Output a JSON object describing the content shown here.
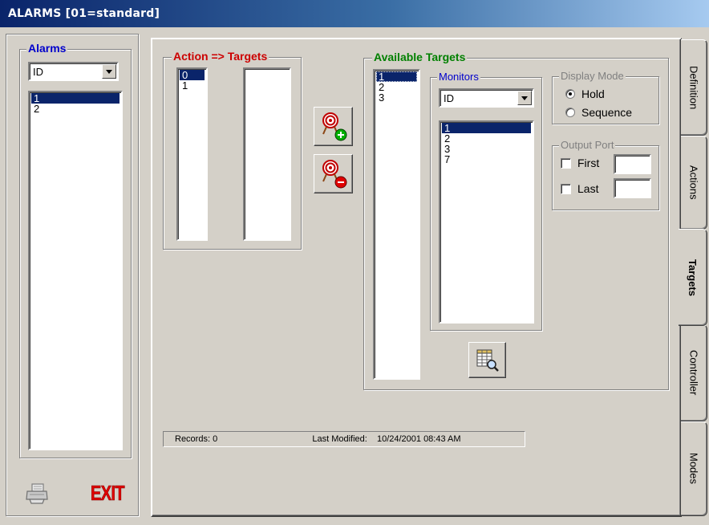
{
  "window": {
    "title": "ALARMS [01=standard]"
  },
  "alarms_panel": {
    "legend": "Alarms",
    "combo_value": "ID",
    "items": [
      "1",
      "2"
    ],
    "selected_index": 0
  },
  "action_targets": {
    "legend_action": "Action",
    "legend_arrow": "=>",
    "legend_targets": "Targets",
    "action_items": [
      "0",
      "1"
    ],
    "target_items": []
  },
  "buttons": {
    "add_target_icon": "target-add-icon",
    "remove_target_icon": "target-remove-icon",
    "preview_icon": "grid-search-icon",
    "print_icon": "printer-icon",
    "exit_label": "EXIT"
  },
  "available_targets": {
    "legend": "Available Targets",
    "items": [
      "1",
      "2",
      "3"
    ],
    "monitors": {
      "legend": "Monitors",
      "combo_value": "ID",
      "items": [
        "1",
        "2",
        "3",
        "7"
      ]
    },
    "display_mode": {
      "legend": "Display Mode",
      "options": [
        "Hold",
        "Sequence"
      ],
      "selected": "Hold"
    },
    "output_port": {
      "legend": "Output Port",
      "first_label": "First",
      "last_label": "Last",
      "first_value": "",
      "last_value": ""
    }
  },
  "status": {
    "records_label": "Records:",
    "records_value": "0",
    "modified_label": "Last Modified:",
    "modified_value": "10/24/2001 08:43 AM"
  },
  "tabs": [
    "Definition",
    "Actions",
    "Targets",
    "Controller",
    "Modes"
  ],
  "active_tab": "Targets",
  "colors": {
    "title_start": "#0a246a",
    "title_end": "#a6caf0",
    "selection": "#0a246a",
    "alarms_legend": "#0000cc",
    "action_legend": "#cc0000",
    "available_legend": "#008000",
    "monitors_legend": "#0000cc",
    "exit_red": "#e00000"
  }
}
